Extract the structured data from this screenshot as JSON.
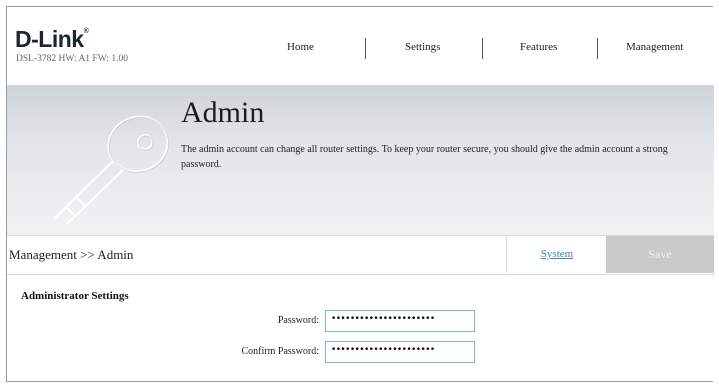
{
  "brand": {
    "logo": "D-Link",
    "logo_mark": "®",
    "hw_info": "DSL-3782  HW: A1  FW: 1.00"
  },
  "nav": {
    "items": [
      {
        "label": "Home"
      },
      {
        "label": "Settings"
      },
      {
        "label": "Features"
      },
      {
        "label": "Management"
      }
    ]
  },
  "banner": {
    "title": "Admin",
    "description": "The admin account can change all router settings. To keep your router secure, you should give the admin account a strong password.",
    "icon": "key-icon"
  },
  "toolbar": {
    "breadcrumb": "Management >> Admin",
    "system_label": "System",
    "save_label": "Save"
  },
  "settings": {
    "section_title": "Administrator Settings",
    "password_label": "Password:",
    "password_value": "••••••••••••••••••••••",
    "confirm_label": "Confirm Password:",
    "confirm_value": "••••••••••••••••••••••"
  },
  "colors": {
    "link": "#3a86b4",
    "save_bg": "#c9c9c9",
    "input_border": "#7fb6c8"
  }
}
